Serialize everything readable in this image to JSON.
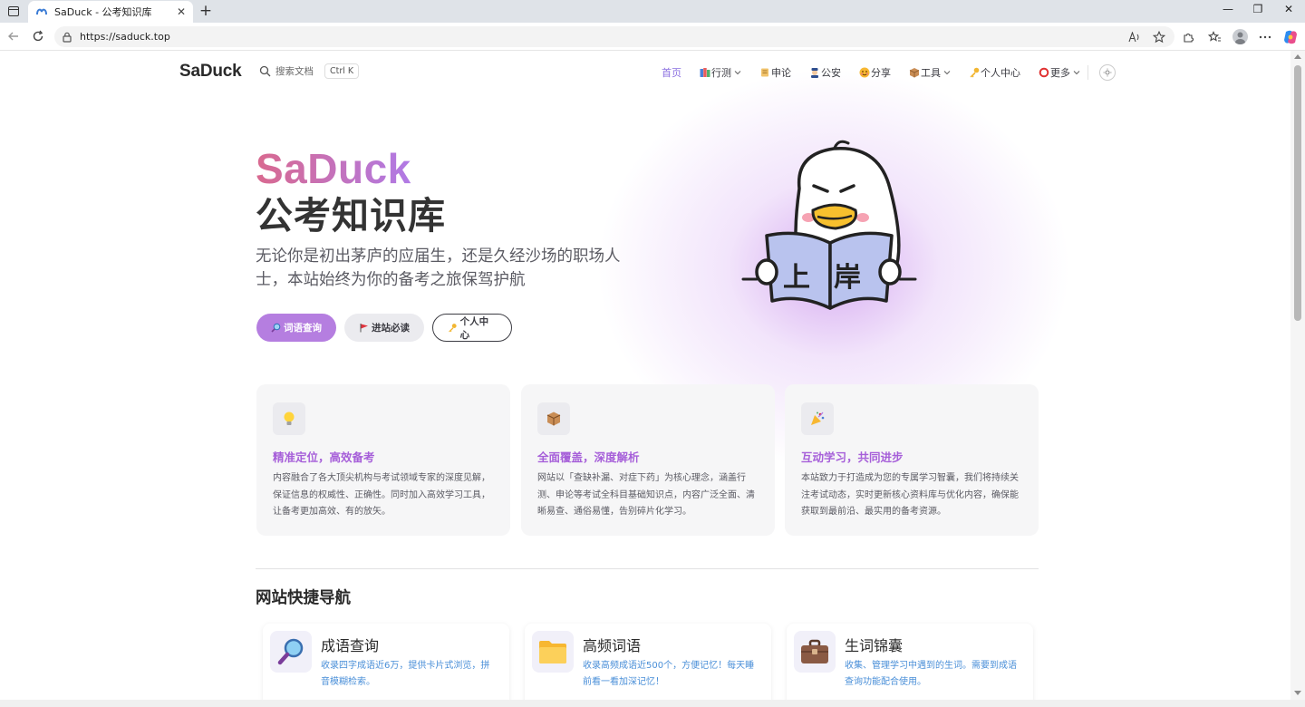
{
  "browser": {
    "tab_title": "SaDuck - 公考知识库",
    "url": "https://saduck.top",
    "new_tab_label": "+",
    "tab_close": "✕",
    "window_minimize": "—",
    "window_restore": "❐",
    "window_close": "✕"
  },
  "nav": {
    "logo": "SaDuck",
    "search_placeholder": "搜索文档",
    "search_shortcut": "Ctrl K",
    "items": [
      {
        "label": "首页",
        "active": true,
        "icon": null,
        "dropdown": false
      },
      {
        "label": "行测",
        "icon": "books-icon",
        "dropdown": true
      },
      {
        "label": "申论",
        "icon": "scroll-icon",
        "dropdown": false
      },
      {
        "label": "公安",
        "icon": "police-officer-icon",
        "dropdown": false
      },
      {
        "label": "分享",
        "icon": "smiling-face-icon",
        "dropdown": false
      },
      {
        "label": "工具",
        "icon": "package-icon",
        "dropdown": true
      },
      {
        "label": "个人中心",
        "icon": "key-icon",
        "dropdown": false
      },
      {
        "label": "更多",
        "icon": "ring-icon",
        "dropdown": true
      }
    ]
  },
  "hero": {
    "name": "SaDuck",
    "text": "公考知识库",
    "tagline": "无论你是初出茅庐的应届生，还是久经沙场的职场人士，本站始终为你的备考之旅保驾护航",
    "mascot_book_text": "上岸",
    "actions": [
      {
        "label": "词语查询",
        "icon": "magnifier-icon",
        "style": "brand"
      },
      {
        "label": "进站必读",
        "icon": "red-flag-icon",
        "style": "alt"
      },
      {
        "label": "个人中心",
        "icon": "key-icon",
        "style": "outline"
      }
    ]
  },
  "features": [
    {
      "icon": "light-bulb-icon",
      "title": "精准定位，高效备考",
      "desc": "内容融合了各大顶尖机构与考试领域专家的深度见解，保证信息的权威性、正确性。同时加入高效学习工具，让备考更加高效、有的放矢。"
    },
    {
      "icon": "package-icon",
      "title": "全面覆盖，深度解析",
      "desc": "网站以「查缺补漏、对症下药」为核心理念，涵盖行测、申论等考试全科目基础知识点，内容广泛全面、清晰易查、通俗易懂，告别碎片化学习。"
    },
    {
      "icon": "party-popper-icon",
      "title": "互动学习，共同进步",
      "desc": "本站致力于打造成为您的专属学习智囊，我们将持续关注考试动态，实时更新核心资料库与优化内容，确保能获取到最前沿、最实用的备考资源。"
    }
  ],
  "quick_nav": {
    "title": "网站快捷导航",
    "cards": [
      {
        "icon": "magnifier-icon",
        "title": "成语查询",
        "desc": "收录四字成语近6万，提供卡片式浏览，拼音模糊检索。"
      },
      {
        "icon": "folder-icon",
        "title": "高频词语",
        "desc": "收录高频成语近500个，方便记忆！每天睡前看一看加深记忆！"
      },
      {
        "icon": "briefcase-icon",
        "title": "生词锦囊",
        "desc": "收集、管理学习中遇到的生词。需要到成语查询功能配合使用。"
      }
    ]
  },
  "colors": {
    "brand": "#b57ee0",
    "feature_title": "#a65fd9",
    "link_blue": "#4a8fd8",
    "active_nav": "#8b6fe0"
  }
}
